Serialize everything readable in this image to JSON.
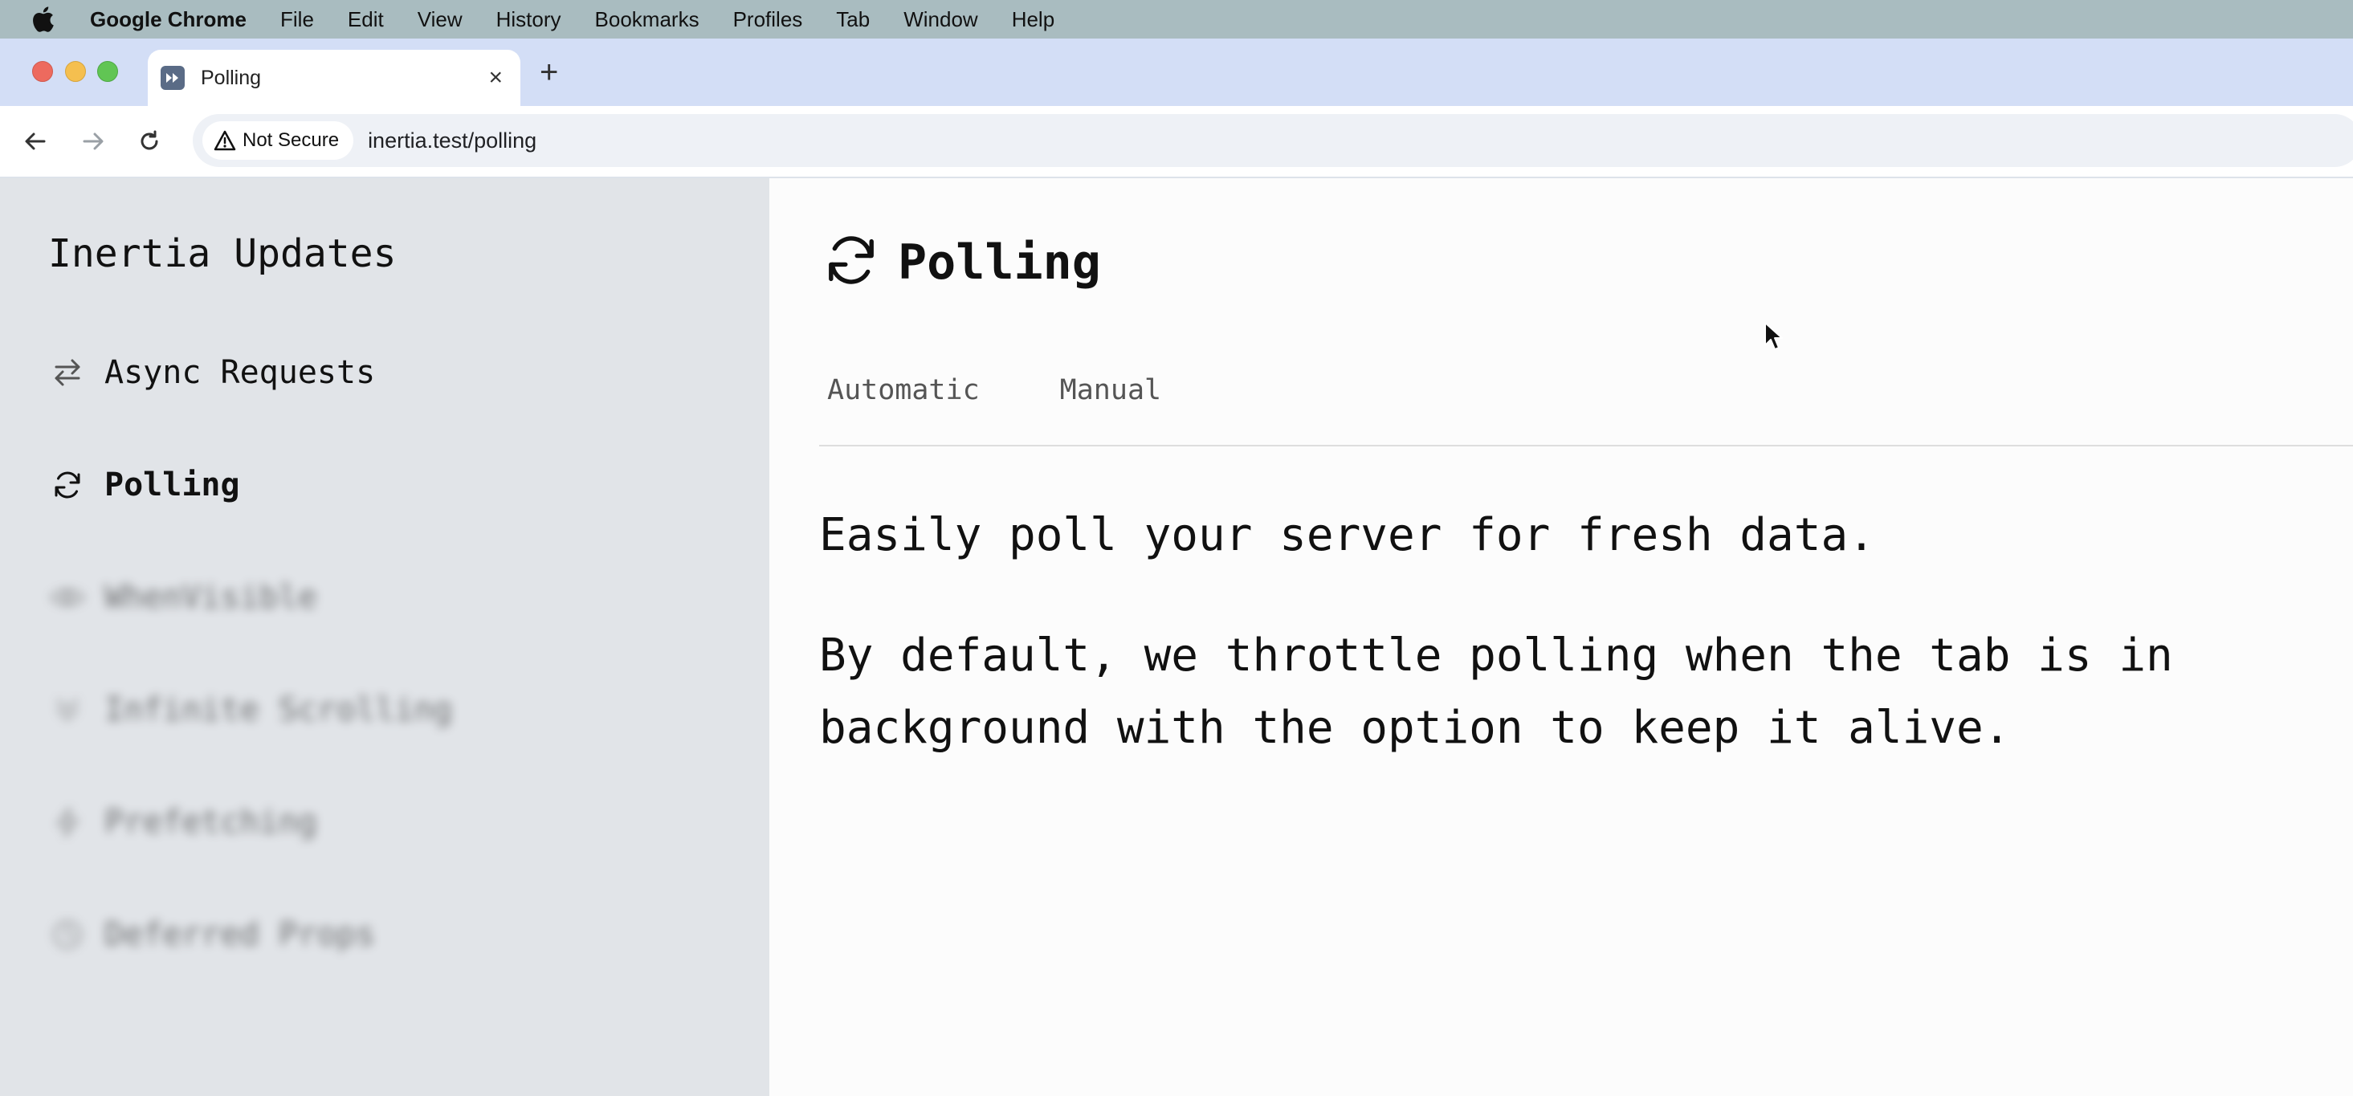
{
  "menubar": {
    "app_name": "Google Chrome",
    "items": [
      "File",
      "Edit",
      "View",
      "History",
      "Bookmarks",
      "Profiles",
      "Tab",
      "Window",
      "Help"
    ]
  },
  "browser": {
    "tab": {
      "title": "Polling",
      "close": "×"
    },
    "new_tab": "+",
    "security_label": "Not Secure",
    "url": "inertia.test/polling"
  },
  "sidebar": {
    "title": "Inertia Updates",
    "items": [
      {
        "label": "Async Requests",
        "icon": "arrows-exchange-icon",
        "state": "normal"
      },
      {
        "label": "Polling",
        "icon": "refresh-icon",
        "state": "active"
      },
      {
        "label": "WhenVisible",
        "icon": "eye-icon",
        "state": "blurred"
      },
      {
        "label": "Infinite Scrolling",
        "icon": "chevrons-down-icon",
        "state": "blurred"
      },
      {
        "label": "Prefetching",
        "icon": "lightning-icon",
        "state": "blurred"
      },
      {
        "label": "Deferred Props",
        "icon": "clock-icon",
        "state": "blurred"
      }
    ]
  },
  "main": {
    "title": "Polling",
    "title_icon": "refresh-icon",
    "tabs": [
      "Automatic",
      "Manual"
    ],
    "paragraphs": [
      "Easily poll your server for fresh data.",
      "By default, we throttle polling when the tab is in background with the option to keep it alive."
    ]
  },
  "colors": {
    "menubar": "#a9bcc0",
    "tabstrip": "#d3def6",
    "sidebar": "#e1e4e8",
    "main": "#fcfcfc"
  }
}
